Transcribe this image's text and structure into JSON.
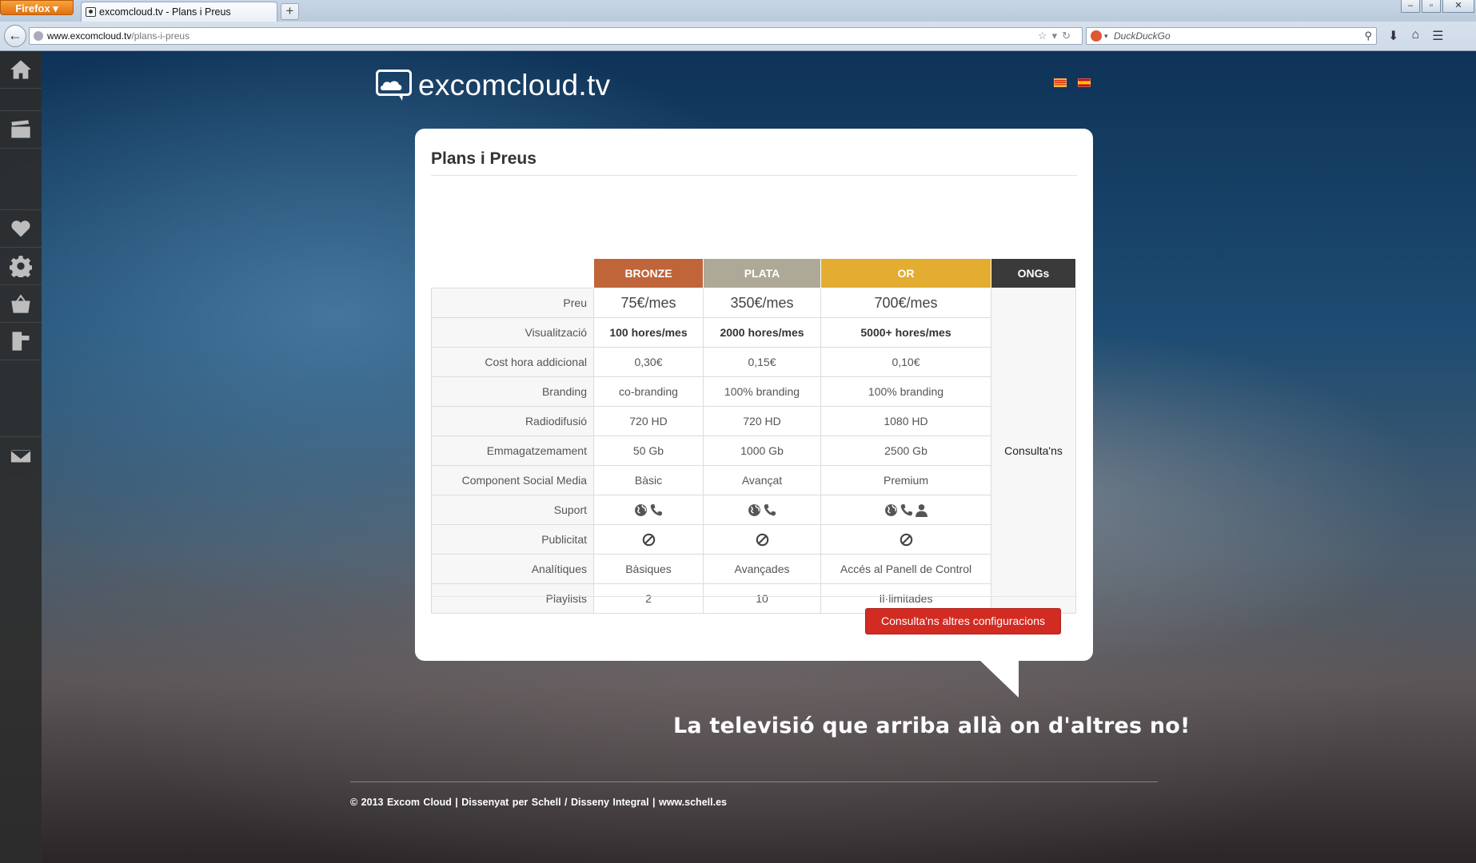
{
  "browser": {
    "app_button": "Firefox",
    "tab_title": "excomcloud.tv - Plans i Preus",
    "url_domain": "www.excomcloud.tv",
    "url_path": "/plans-i-preus",
    "search_placeholder": "DuckDuckGo"
  },
  "header": {
    "logo_text": "excomcloud.tv"
  },
  "card": {
    "title": "Plans i Preus",
    "plans": [
      {
        "name": "BRONZE",
        "color": "#c0653a"
      },
      {
        "name": "PLATA",
        "color": "#aea897"
      },
      {
        "name": "OR",
        "color": "#e3ad31"
      },
      {
        "name": "ONGs",
        "color": "#3a3a3a"
      }
    ],
    "rows": [
      {
        "label": "Preu",
        "values": [
          "75€/mes",
          "350€/mes",
          "700€/mes"
        ]
      },
      {
        "label": "Visualització",
        "values": [
          "100 hores/mes",
          "2000 hores/mes",
          "5000+ hores/mes"
        ]
      },
      {
        "label": "Cost hora addicional",
        "values": [
          "0,30€",
          "0,15€",
          "0,10€"
        ]
      },
      {
        "label": "Branding",
        "values": [
          "co-branding",
          "100% branding",
          "100% branding"
        ]
      },
      {
        "label": "Radiodifusió",
        "values": [
          "720 HD",
          "720 HD",
          "1080 HD"
        ]
      },
      {
        "label": "Emmagatzemament",
        "values": [
          "50 Gb",
          "1000 Gb",
          "2500 Gb"
        ]
      },
      {
        "label": "Component Social Media",
        "values": [
          "Bàsic",
          "Avançat",
          "Premium"
        ]
      },
      {
        "label": "Suport",
        "icons": [
          [
            "globe-icon",
            "phone-icon"
          ],
          [
            "globe-icon",
            "phone-icon"
          ],
          [
            "globe-icon",
            "phone-icon",
            "person-icon"
          ]
        ]
      },
      {
        "label": "Publicitat",
        "icons": [
          [
            "no-ads-icon"
          ],
          [
            "no-ads-icon"
          ],
          [
            "no-ads-icon"
          ]
        ]
      },
      {
        "label": "Analítiques",
        "values": [
          "Bàsiques",
          "Avançades",
          "Accés al Panell de Control"
        ]
      },
      {
        "label": "Playlists",
        "values": [
          "2",
          "10",
          "Il·limitades"
        ]
      }
    ],
    "ong_text": "Consulta'ns",
    "cta_label": "Consulta'ns altres configuracions"
  },
  "slogan": "La televisió que arriba allà on d'altres no!",
  "footer": {
    "text": "© 2013 Excom Cloud   |   Dissenyat per Schell / Disseny Integral   |   www.schell.es"
  },
  "sidenav": [
    "home-icon",
    "clapperboard-icon",
    "heart-icon",
    "gear-icon",
    "basket-icon",
    "film-icon",
    "mail-icon"
  ]
}
